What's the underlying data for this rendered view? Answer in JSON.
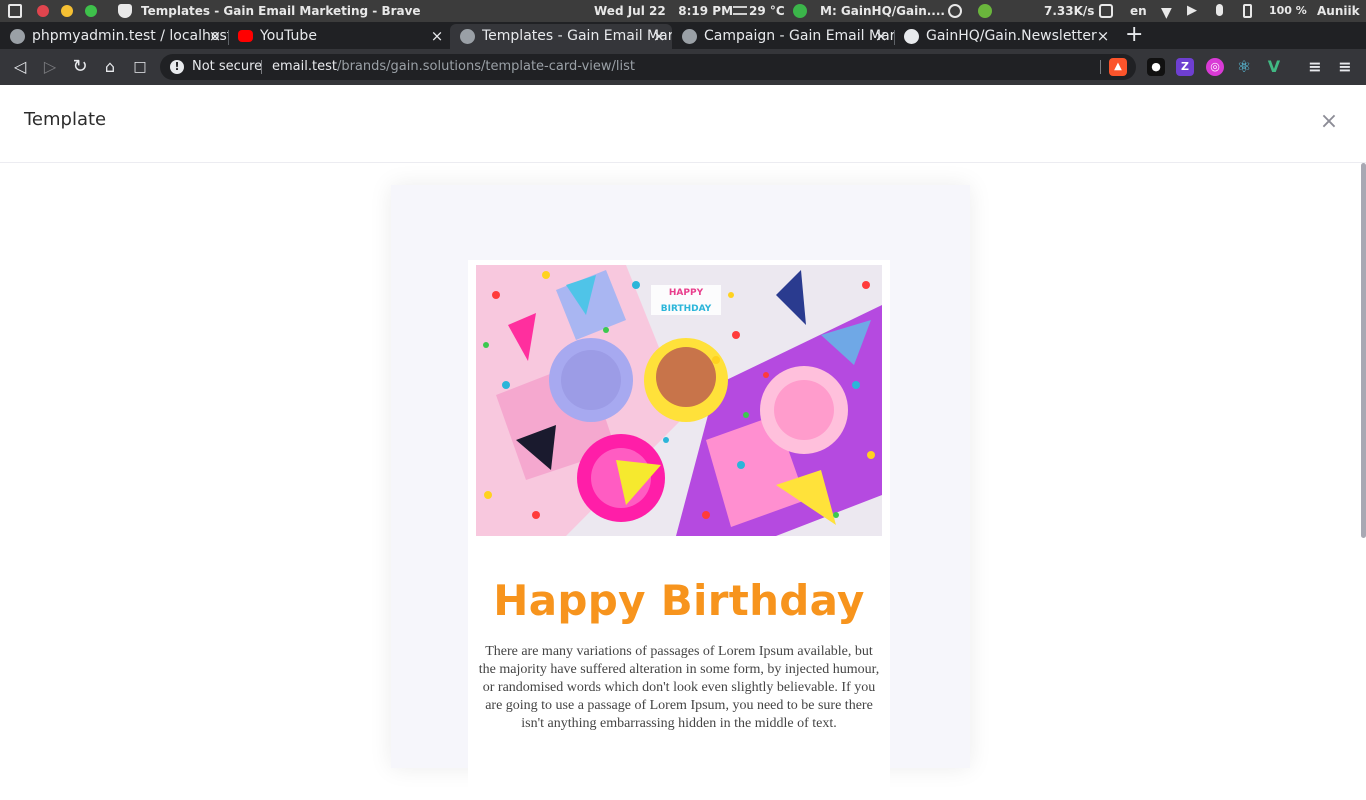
{
  "os_bar": {
    "window_title": "Templates - Gain Email Marketing - Brave",
    "datetime": "Wed Jul 22   8:19 PM",
    "weather": "29 °C",
    "mail": "M: GainHQ/Gain....",
    "net_speed": "7.33K/s",
    "lang": "en",
    "battery": "100 %",
    "user": "Auniik"
  },
  "tabs": [
    {
      "title": "phpmyadmin.test / localhost",
      "icon": "globe-icon"
    },
    {
      "title": "YouTube",
      "icon": "youtube-icon"
    },
    {
      "title": "Templates - Gain Email Marketing",
      "icon": "globe-icon",
      "active": true
    },
    {
      "title": "Campaign - Gain Email Marketing",
      "icon": "globe-icon"
    },
    {
      "title": "GainHQ/Gain.Newsletter",
      "icon": "github-icon"
    }
  ],
  "new_tab_label": "+",
  "toolbar": {
    "security_label": "Not secure",
    "url_host": "email.test",
    "url_path": "/brands/gain.solutions/template-card-view/list"
  },
  "page": {
    "title": "Template",
    "close_glyph": "×"
  },
  "email": {
    "headline": "Happy Birthday",
    "body": "There are many variations of passages of Lorem Ipsum available, but the majority have suffered alteration in some form, by injected humour, or randomised words which don't look even slightly believable. If you are going to use a passage of Lorem Ipsum, you need to be sure there isn't anything embarrassing hidden in the middle of text.",
    "banner_text": "HAPPY BIRTHDAY"
  },
  "colors": {
    "accent": "#f7941d",
    "preview_bg": "#f6f6fb"
  }
}
